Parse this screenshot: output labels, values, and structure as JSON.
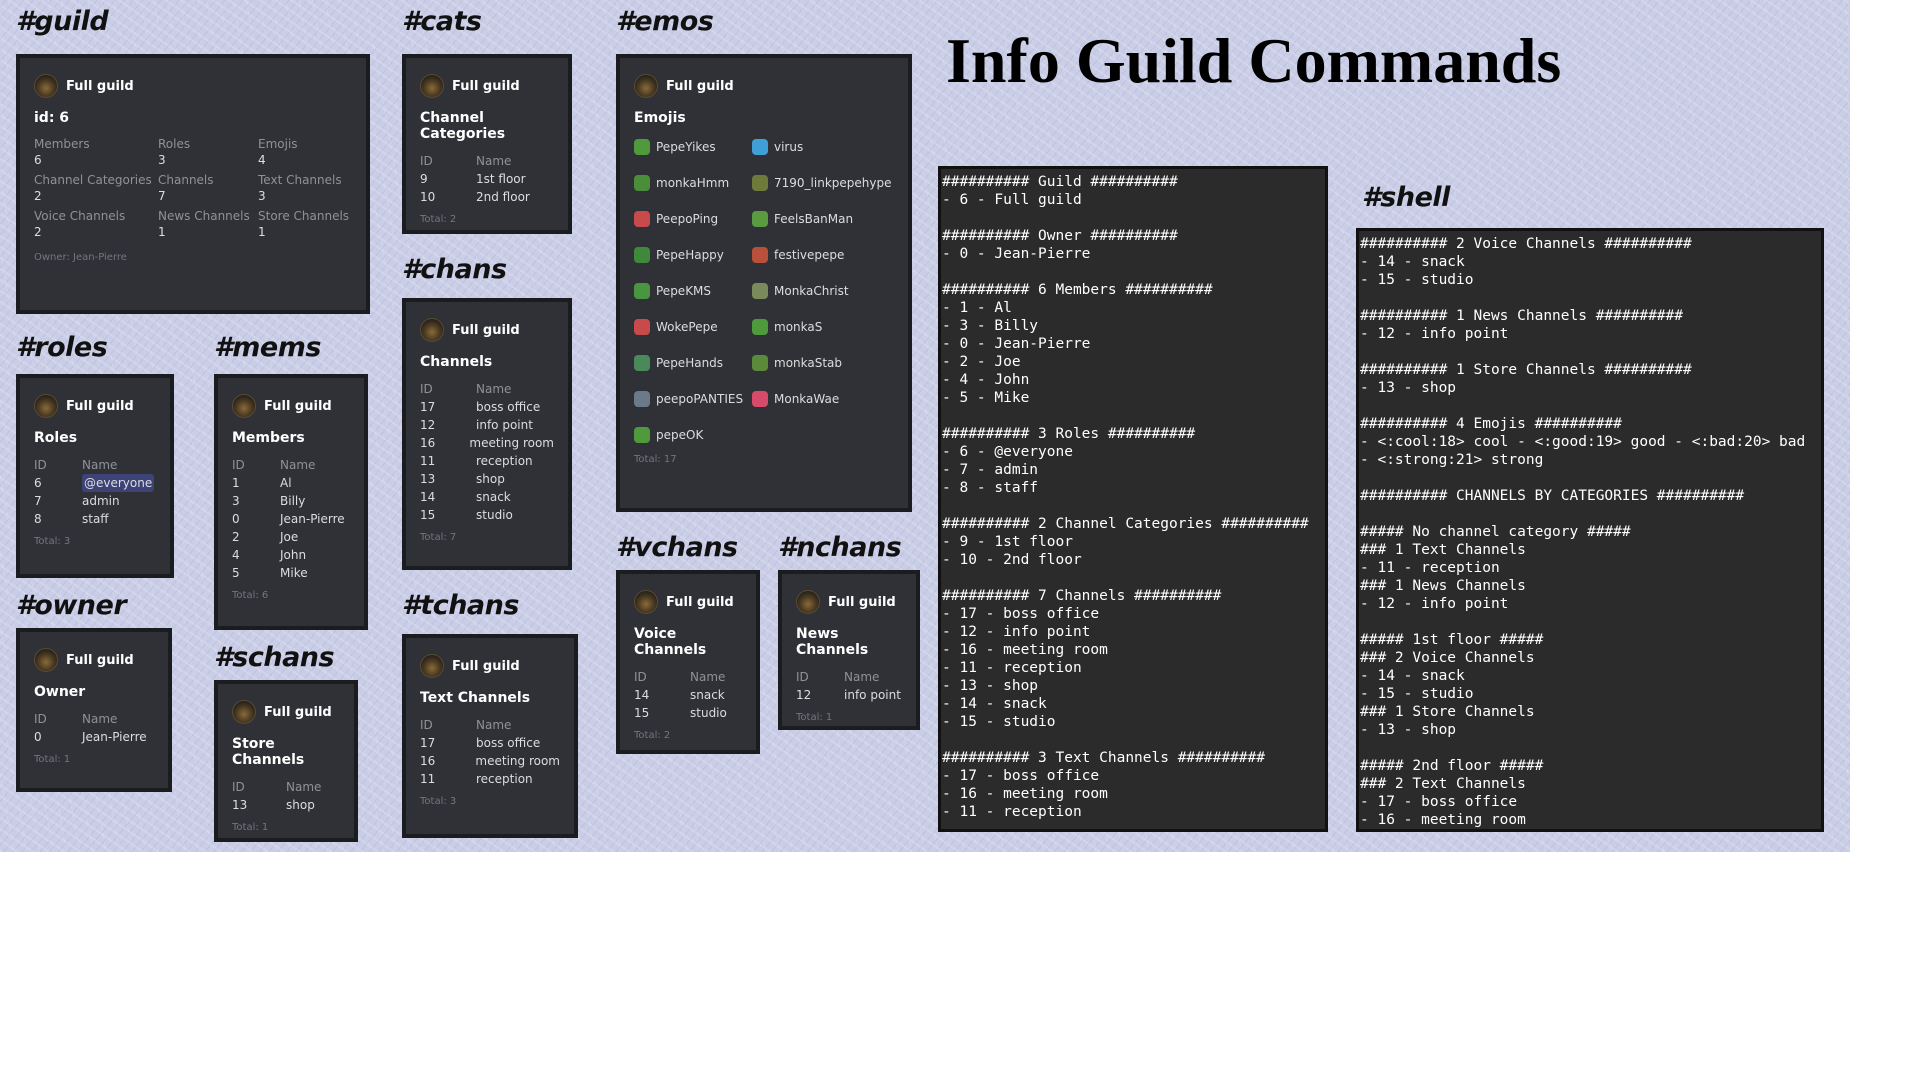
{
  "labels": {
    "guild": "#guild",
    "cats": "#cats",
    "emos": "#emos",
    "chans": "#chans",
    "roles": "#roles",
    "mems": "#mems",
    "owner": "#owner",
    "schans": "#schans",
    "tchans": "#tchans",
    "vchans": "#vchans",
    "nchans": "#nchans",
    "shell": "#shell"
  },
  "page_title": "Info Guild Commands",
  "author": "Full guild",
  "col_id": "ID",
  "col_name": "Name",
  "guild_card": {
    "title": "id: 6",
    "fields": [
      {
        "name": "Members",
        "value": "6"
      },
      {
        "name": "Roles",
        "value": "3"
      },
      {
        "name": "Emojis",
        "value": "4"
      },
      {
        "name": "Channel Categories",
        "value": "2"
      },
      {
        "name": "Channels",
        "value": "7"
      },
      {
        "name": "Text Channels",
        "value": "3"
      },
      {
        "name": "Voice Channels",
        "value": "2"
      },
      {
        "name": "News Channels",
        "value": "1"
      },
      {
        "name": "Store Channels",
        "value": "1"
      }
    ],
    "footer": "Owner: Jean-Pierre"
  },
  "cats_card": {
    "title": "Channel Categories",
    "rows": [
      {
        "id": "9",
        "name": "1st floor"
      },
      {
        "id": "10",
        "name": "2nd floor"
      }
    ],
    "footer": "Total: 2"
  },
  "emos_card": {
    "title": "Emojis",
    "emojis": [
      {
        "name": "PepeYikes",
        "color": "#4f9a3c"
      },
      {
        "name": "virus",
        "color": "#3fa0d8"
      },
      {
        "name": "monkaHmm",
        "color": "#4a8e3a"
      },
      {
        "name": "7190_linkpepehype",
        "color": "#6d7a3a"
      },
      {
        "name": "PeepoPing",
        "color": "#c84a4a"
      },
      {
        "name": "FeelsBanMan",
        "color": "#5a9a40"
      },
      {
        "name": "PepeHappy",
        "color": "#3f8a3a"
      },
      {
        "name": "festivepepe",
        "color": "#b8503a"
      },
      {
        "name": "PepeKMS",
        "color": "#4a9640"
      },
      {
        "name": "MonkaChrist",
        "color": "#7a8a5a"
      },
      {
        "name": "WokePepe",
        "color": "#c84a4a"
      },
      {
        "name": "monkaS",
        "color": "#4f9a3c"
      },
      {
        "name": "PepeHands",
        "color": "#4a8a5a"
      },
      {
        "name": "monkaStab",
        "color": "#5a8a3a"
      },
      {
        "name": "peepoPANTIES",
        "color": "#6a7a8a"
      },
      {
        "name": "MonkaWae",
        "color": "#d84a6a"
      },
      {
        "name": "pepeOK",
        "color": "#4f9a3c"
      }
    ],
    "footer": "Total: 17"
  },
  "chans_card": {
    "title": "Channels",
    "rows": [
      {
        "id": "17",
        "name": "boss office"
      },
      {
        "id": "12",
        "name": "info point"
      },
      {
        "id": "16",
        "name": "meeting room"
      },
      {
        "id": "11",
        "name": "reception"
      },
      {
        "id": "13",
        "name": "shop"
      },
      {
        "id": "14",
        "name": "snack"
      },
      {
        "id": "15",
        "name": "studio"
      }
    ],
    "footer": "Total: 7"
  },
  "roles_card": {
    "title": "Roles",
    "rows": [
      {
        "id": "6",
        "name": "@everyone"
      },
      {
        "id": "7",
        "name": "admin"
      },
      {
        "id": "8",
        "name": "staff"
      }
    ],
    "footer": "Total: 3"
  },
  "mems_card": {
    "title": "Members",
    "rows": [
      {
        "id": "1",
        "name": "Al"
      },
      {
        "id": "3",
        "name": "Billy"
      },
      {
        "id": "0",
        "name": "Jean-Pierre"
      },
      {
        "id": "2",
        "name": "Joe"
      },
      {
        "id": "4",
        "name": "John"
      },
      {
        "id": "5",
        "name": "Mike"
      }
    ],
    "footer": "Total: 6"
  },
  "owner_card": {
    "title": "Owner",
    "rows": [
      {
        "id": "0",
        "name": "Jean-Pierre"
      }
    ],
    "footer": "Total: 1"
  },
  "schans_card": {
    "title": "Store Channels",
    "rows": [
      {
        "id": "13",
        "name": "shop"
      }
    ],
    "footer": "Total: 1"
  },
  "tchans_card": {
    "title": "Text Channels",
    "rows": [
      {
        "id": "17",
        "name": "boss office"
      },
      {
        "id": "16",
        "name": "meeting room"
      },
      {
        "id": "11",
        "name": "reception"
      }
    ],
    "footer": "Total: 3"
  },
  "vchans_card": {
    "title": "Voice Channels",
    "rows": [
      {
        "id": "14",
        "name": "snack"
      },
      {
        "id": "15",
        "name": "studio"
      }
    ],
    "footer": "Total: 2"
  },
  "nchans_card": {
    "title": "News Channels",
    "rows": [
      {
        "id": "12",
        "name": "info point"
      }
    ],
    "footer": "Total: 1"
  },
  "shell_left": "########## Guild ##########\n- 6 - Full guild\n\n########## Owner ##########\n- 0 - Jean-Pierre\n\n########## 6 Members ##########\n- 1 - Al\n- 3 - Billy\n- 0 - Jean-Pierre\n- 2 - Joe\n- 4 - John\n- 5 - Mike\n\n########## 3 Roles ##########\n- 6 - @everyone\n- 7 - admin\n- 8 - staff\n\n########## 2 Channel Categories ##########\n- 9 - 1st floor\n- 10 - 2nd floor\n\n########## 7 Channels ##########\n- 17 - boss office\n- 12 - info point\n- 16 - meeting room\n- 11 - reception\n- 13 - shop\n- 14 - snack\n- 15 - studio\n\n########## 3 Text Channels ##########\n- 17 - boss office\n- 16 - meeting room\n- 11 - reception",
  "shell_right": "########## 2 Voice Channels ##########\n- 14 - snack\n- 15 - studio\n\n########## 1 News Channels ##########\n- 12 - info point\n\n########## 1 Store Channels ##########\n- 13 - shop\n\n########## 4 Emojis ##########\n- <:cool:18> cool - <:good:19> good - <:bad:20> bad\n- <:strong:21> strong\n\n########## CHANNELS BY CATEGORIES ##########\n\n##### No channel category #####\n### 1 Text Channels\n- 11 - reception\n### 1 News Channels\n- 12 - info point\n\n##### 1st floor #####\n### 2 Voice Channels\n- 14 - snack\n- 15 - studio\n### 1 Store Channels\n- 13 - shop\n\n##### 2nd floor #####\n### 2 Text Channels\n- 17 - boss office\n- 16 - meeting room"
}
